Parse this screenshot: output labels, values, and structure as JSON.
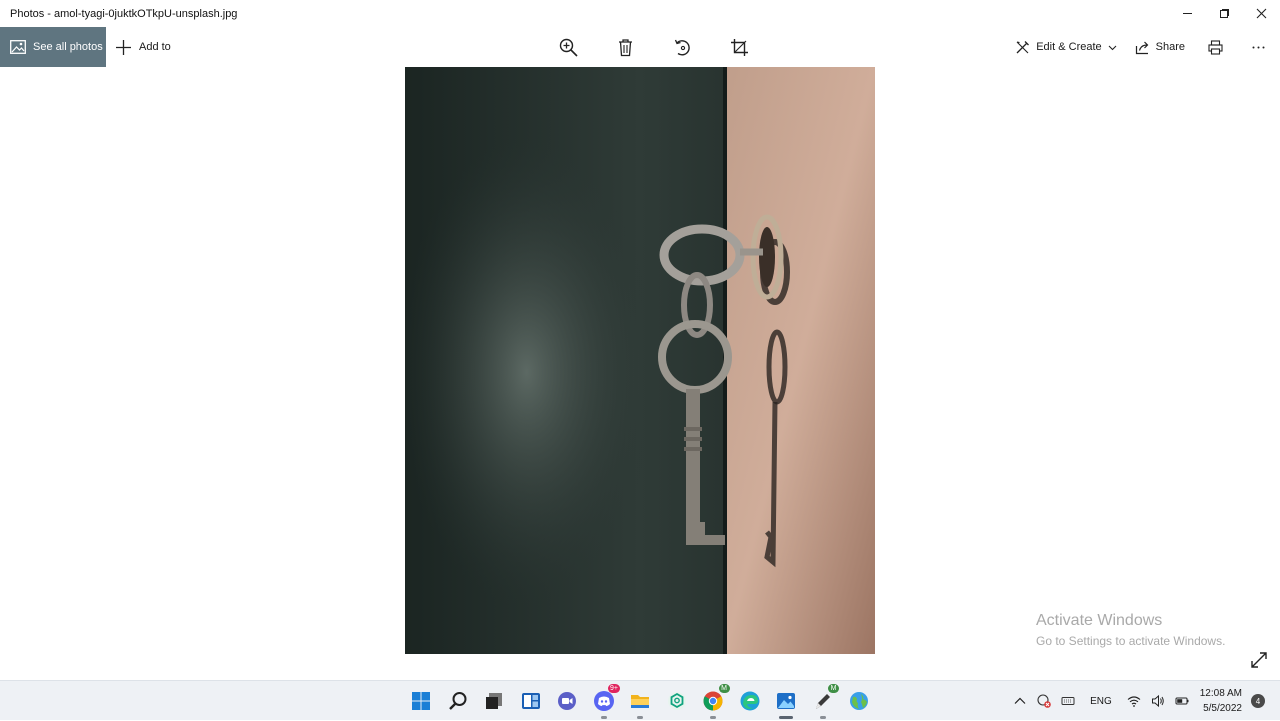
{
  "window": {
    "title": "Photos - amol-tyagi-0juktkOTkpU-unsplash.jpg",
    "controls": [
      "minimize-icon",
      "maximize-icon",
      "close-icon"
    ]
  },
  "toolbar": {
    "see_all_photos": "See all photos",
    "add_to": "Add to",
    "center_tools": [
      "zoom-in-icon",
      "delete-icon",
      "rotate-icon",
      "crop-icon"
    ],
    "edit_create": "Edit & Create",
    "share": "Share",
    "print_icon": "print-icon",
    "more_icon": "more-icon"
  },
  "photo": {
    "description_icon": "image",
    "colors": {
      "dark_wall": "#1f2d2a",
      "door_edge": "#c7a592",
      "key": "#8e8b86"
    }
  },
  "watermark": {
    "title": "Activate Windows",
    "subtitle": "Go to Settings to activate Windows."
  },
  "taskbar": {
    "apps": [
      {
        "name": "start"
      },
      {
        "name": "search"
      },
      {
        "name": "task-view"
      },
      {
        "name": "widgets"
      },
      {
        "name": "chat"
      },
      {
        "name": "discord",
        "badge": "9+"
      },
      {
        "name": "file-explorer"
      },
      {
        "name": "chatgpt"
      },
      {
        "name": "chrome",
        "badge": "M"
      },
      {
        "name": "edge"
      },
      {
        "name": "photos"
      },
      {
        "name": "pen-tool",
        "badge": "M"
      },
      {
        "name": "browser-globe"
      }
    ],
    "tray": {
      "language": "ENG",
      "time": "12:08 AM",
      "date": "5/5/2022",
      "notifications": "4"
    }
  },
  "accent": "#5f7580"
}
